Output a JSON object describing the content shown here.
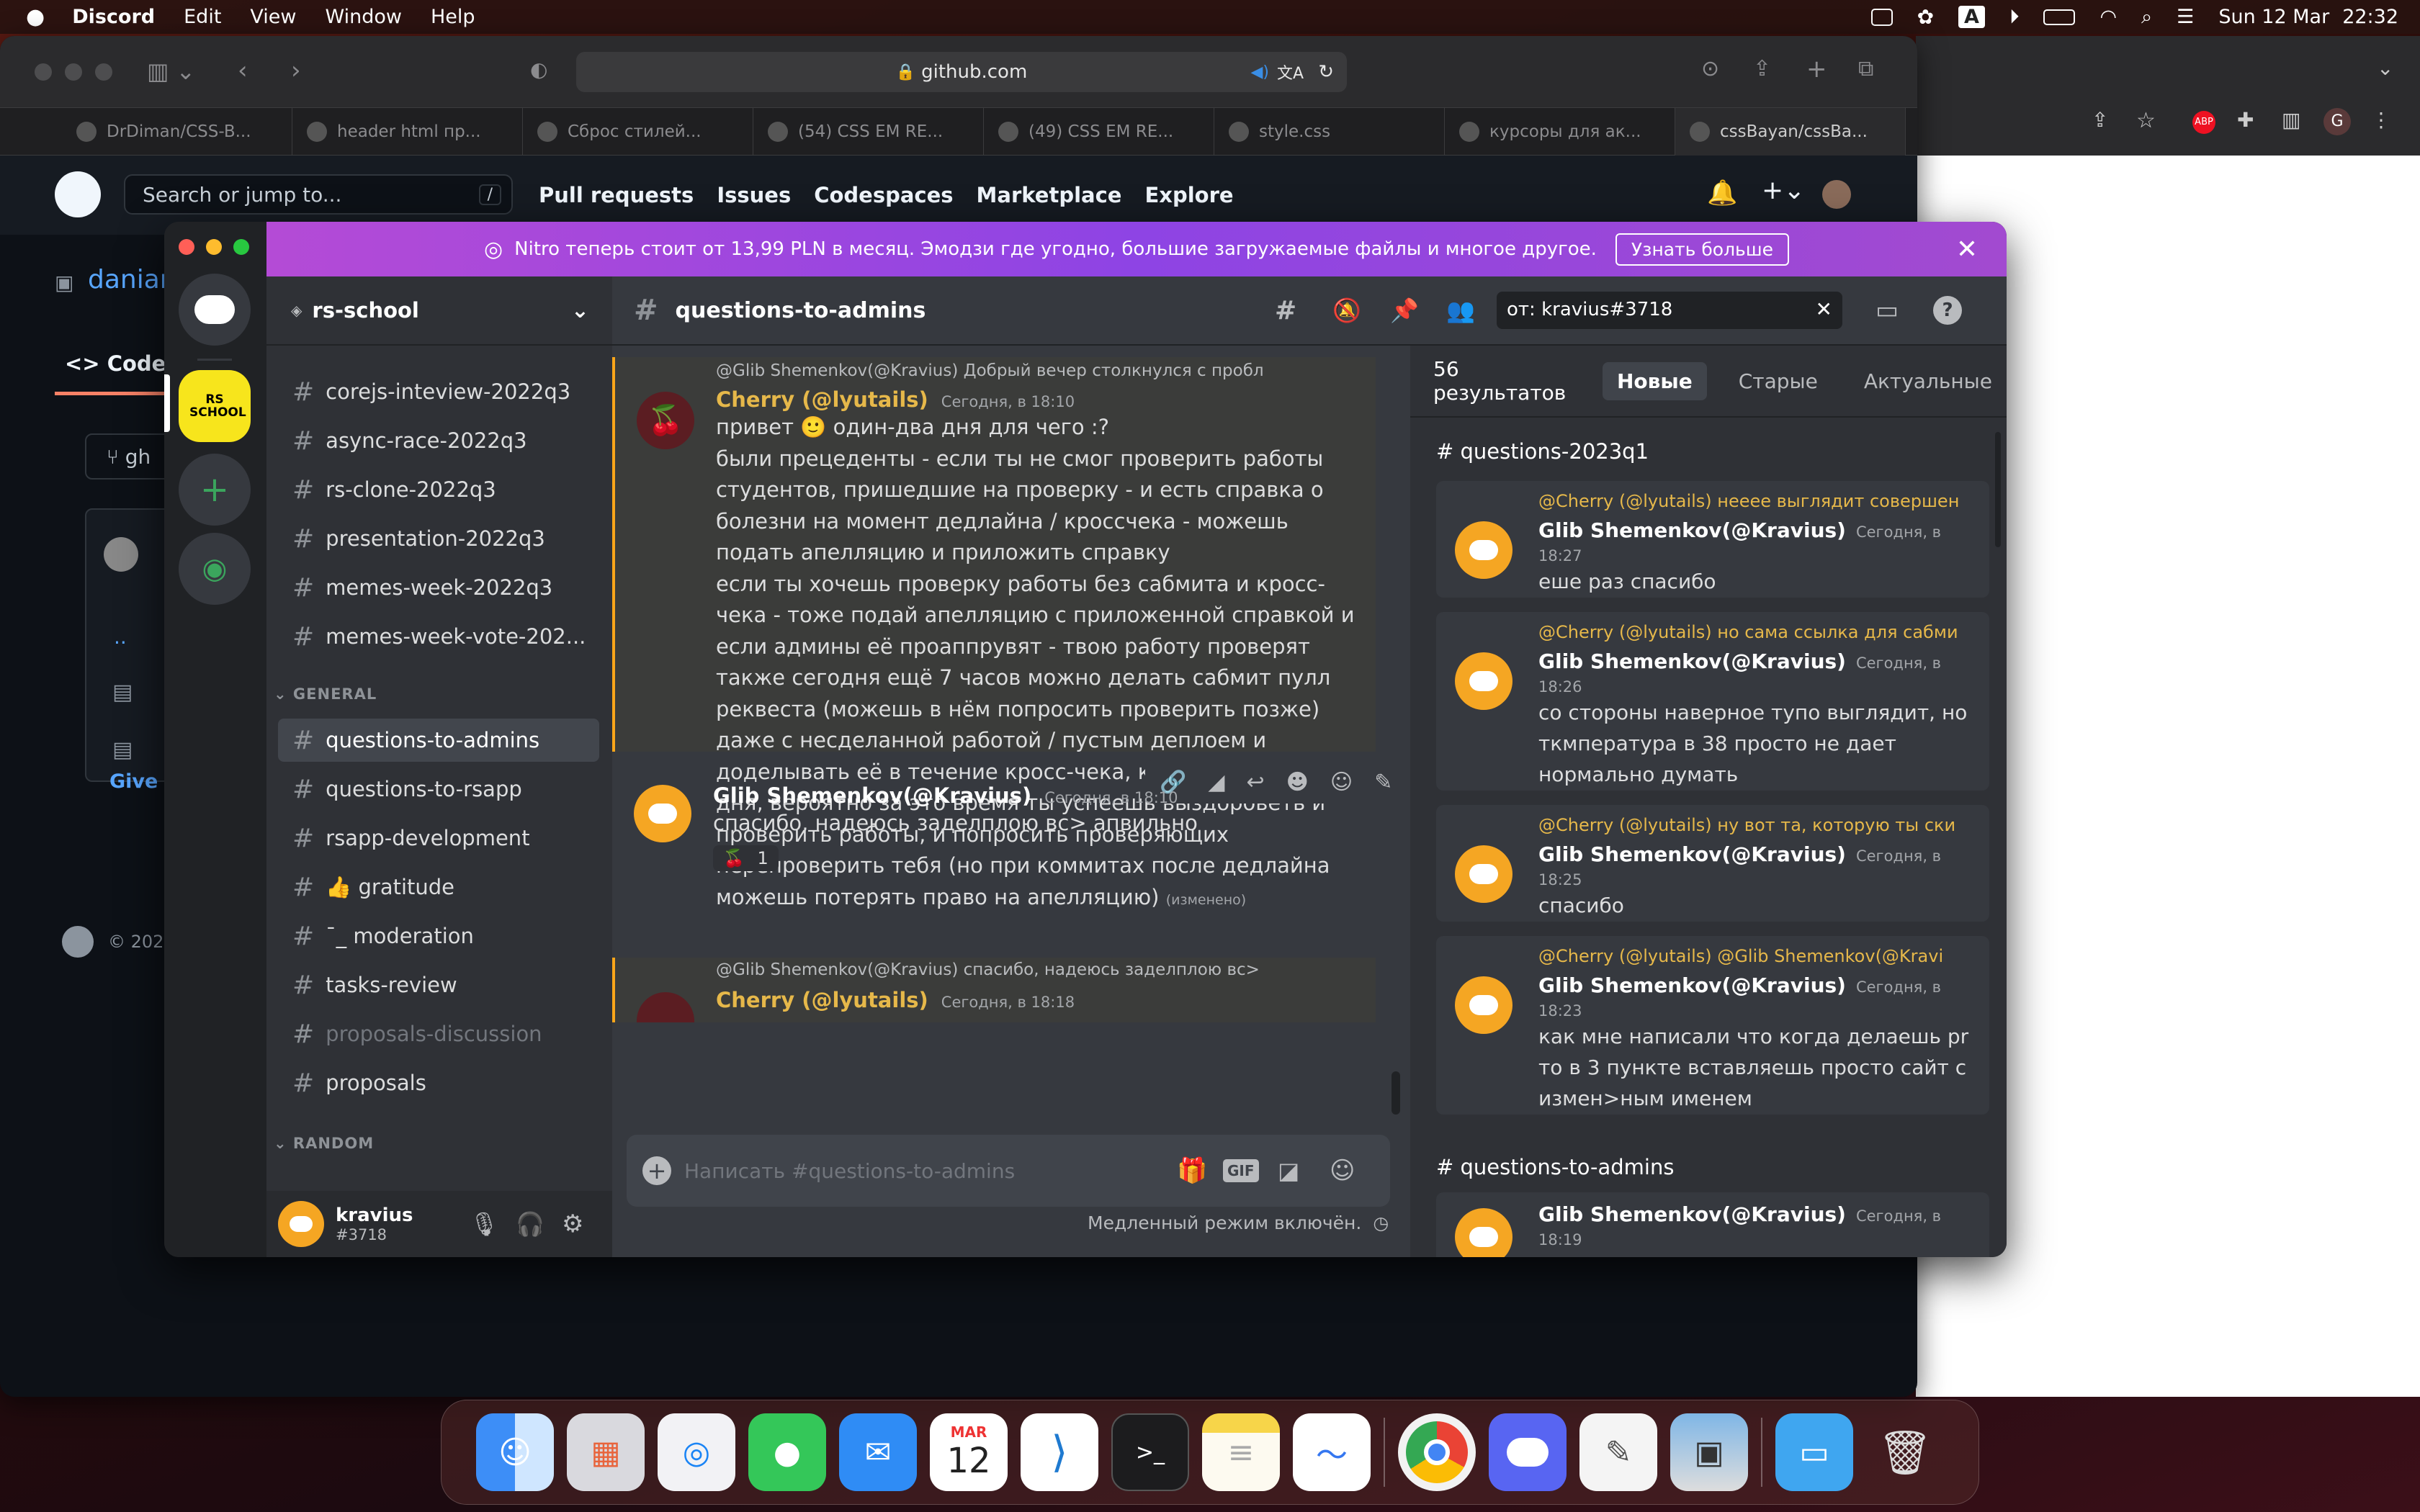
{
  "menubar": {
    "app": "Discord",
    "items": [
      "Edit",
      "View",
      "Window",
      "Help"
    ],
    "date": "Sun 12 Mar",
    "time": "22:32",
    "input_source": "A"
  },
  "safari": {
    "url": "github.com",
    "tabs": [
      "DrDiman/CSS-B...",
      "header html пр...",
      "Сброс стилей...",
      "(54) CSS EM RE...",
      "(49) CSS EM RE...",
      "style.css",
      "курсоры для ак...",
      "cssBayan/cssBa..."
    ],
    "gh_search": "Search or jump to...",
    "gh_search_key": "/",
    "gh_nav": [
      "Pull requests",
      "Issues",
      "Codespaces",
      "Marketplace",
      "Explore"
    ],
    "repo_fragment": "danian",
    "code_tab": "Code",
    "branch_fragment": "gh",
    "give_fragment": "Give f",
    "footer_fragment": "© 202",
    "dots": ".."
  },
  "chrome": {
    "abp": "ABP",
    "profile": "G"
  },
  "discord": {
    "nitro_text": "Nitro теперь стоит от 13,99 PLN в месяц. Эмодзи где угодно, большие загружаемые файлы и многое другое.",
    "nitro_button": "Узнать больше",
    "server_badge": "RS SCHOOL",
    "server_name": "rs-school",
    "channels": [
      {
        "name": "corejs-inteview-2022q3"
      },
      {
        "name": "async-race-2022q3"
      },
      {
        "name": "rs-clone-2022q3"
      },
      {
        "name": "presentation-2022q3"
      },
      {
        "name": "memes-week-2022q3"
      },
      {
        "name": "memes-week-vote-202..."
      }
    ],
    "category_general": "GENERAL",
    "general_channels": [
      {
        "name": "questions-to-admins"
      },
      {
        "name": "questions-to-rsapp"
      },
      {
        "name": "rsapp-development"
      },
      {
        "name": "👍 gratitude"
      },
      {
        "name": "¯_ moderation"
      },
      {
        "name": "tasks-review"
      },
      {
        "name": "proposals-discussion"
      },
      {
        "name": "proposals"
      }
    ],
    "category_random": "RANDOM",
    "user": {
      "name": "kravius",
      "tag": "#3718"
    },
    "channel_title": "questions-to-admins",
    "search_query": "от: kravius#3718",
    "messages": {
      "m1_reply": "@Glib Shemenkov(@Kravius) Добрый вечер столкнулся с проблем",
      "m1_name": "Cherry (@lyutails)",
      "m1_ts": "Сегодня, в 18:10",
      "m1_lines": [
        "привет 🙂 один-два дня для чего :?",
        "были прецеденты - если ты не смог проверить работы",
        "студентов, пришедшие на проверку - и есть справка о",
        "болезни на момент дедлайна / кроссчека - можешь",
        "подать апелляцию и приложить справку",
        "если ты хочешь проверку работы без сабмита и кросс-",
        "чека - тоже подай апелляцию с приложенной справкой и",
        "если админы её проаппрувят - твою работу проверят",
        "также сегодня ещё 7 часов можно делать сабмит пулл",
        "реквеста (можешь в нём попросить проверить позже)",
        "даже с несделанной работой / пустым деплоем и",
        "доделывать её в течение кросс-чека, который длится 4",
        "дня, вероятно за это время ты успеешь выздороветь и",
        "проверить работы, и попросить проверяющих",
        "перепроверить тебя (но при коммитах после дедлайна",
        "можешь потерять право на апелляцию)"
      ],
      "m1_edited": "(изменено)",
      "m2_name": "Glib Shemenkov(@Kravius)",
      "m2_ts": "Сегодня, в 18:10",
      "m2_body": "спасибо, надеюсь заделплою вс> апвильно",
      "m2_reaction": "🍒",
      "m2_reaction_count": "1",
      "m3_reply": "@Glib Shemenkov(@Kravius) спасибо, надеюсь заделплою вс> апв",
      "m3_name": "Cherry (@lyutails)",
      "m3_ts": "Сегодня, в 18:18"
    },
    "composer_placeholder": "Написать #questions-to-admins",
    "slowmode": "Медленный режим включён.",
    "gif_label": "GIF",
    "search_panel": {
      "count": "56 результатов",
      "tabs": [
        "Новые",
        "Старые",
        "Актуальные"
      ],
      "section1": "# questions-2023q1",
      "results": [
        {
          "reply": "@Cherry (@lyutails) нееее выглядит совершен",
          "name": "Glib Shemenkov(@Kravius)",
          "ts": "Сегодня, в 18:27",
          "body": [
            "еше раз спасибо"
          ]
        },
        {
          "reply": "@Cherry (@lyutails) но сама ссылка для сабми",
          "name": "Glib Shemenkov(@Kravius)",
          "ts": "Сегодня, в 18:26",
          "body": [
            "со стороны наверное тупо выглядит, но",
            "ткмпература в 38 просто не дает",
            "нормально думать"
          ]
        },
        {
          "reply": "@Cherry (@lyutails) ну вот та, которую ты ски",
          "name": "Glib Shemenkov(@Kravius)",
          "ts": "Сегодня, в 18:25",
          "body": [
            "спасибо"
          ]
        },
        {
          "reply": "@Cherry (@lyutails) @Glib Shemenkov(@Kravi",
          "name": "Glib Shemenkov(@Kravius)",
          "ts": "Сегодня, в 18:23",
          "body": [
            "как мне написали что когда делаешь pr",
            "то в 3 пункте вставляешь просто сайт с",
            "измен>ным именем"
          ]
        }
      ],
      "section2": "# questions-to-admins",
      "last_name": "Glib Shemenkov(@Kravius)",
      "last_ts": "Сегодня, в 18:19"
    }
  },
  "dock": {
    "calendar_month": "MAR",
    "calendar_day": "12"
  }
}
